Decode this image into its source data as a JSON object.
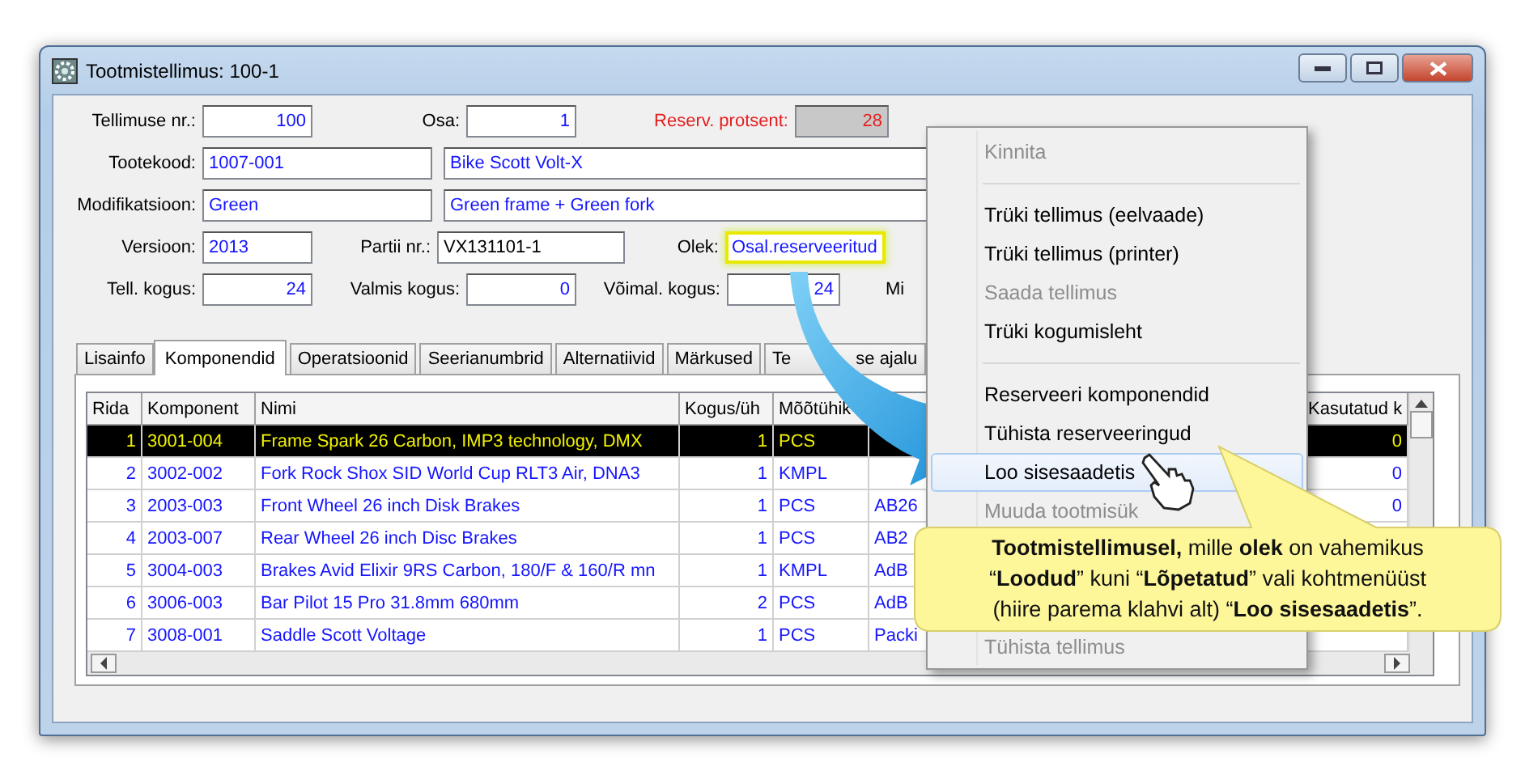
{
  "window": {
    "title": "Tootmistellimus: 100-1"
  },
  "form_rows": [
    [
      {
        "kind": "label",
        "text": "Tellimuse nr.:"
      },
      {
        "kind": "number_field",
        "text": "100"
      },
      {
        "kind": "label",
        "text": "Osa:"
      },
      {
        "kind": "number_field",
        "text": "1"
      },
      {
        "kind": "warning_label",
        "text": "Reserv. protsent:"
      },
      {
        "kind": "readonly_field",
        "text": "28"
      }
    ],
    [
      {
        "kind": "label",
        "text": "Tootekood:"
      },
      {
        "kind": "text_field",
        "text": "1007-001"
      },
      {
        "kind": "text_field",
        "text": "Bike Scott Volt-X"
      }
    ],
    [
      {
        "kind": "label",
        "text": "Modifikatsioon:"
      },
      {
        "kind": "text_field",
        "text": "Green"
      },
      {
        "kind": "text_field",
        "text": "Green frame + Green fork"
      }
    ],
    [
      {
        "kind": "label",
        "text": "Versioon:"
      },
      {
        "kind": "text_field",
        "text": "2013"
      },
      {
        "kind": "label",
        "text": "Partii nr.:"
      },
      {
        "kind": "plain_field",
        "text": "VX131101-1"
      },
      {
        "kind": "label",
        "text": "Olek:"
      },
      {
        "kind": "highlighted_field",
        "text": "Osal.reserveeritud"
      }
    ],
    [
      {
        "kind": "label",
        "text": "Tell. kogus:"
      },
      {
        "kind": "number_field",
        "text": "24"
      },
      {
        "kind": "label",
        "text": "Valmis kogus:"
      },
      {
        "kind": "number_field",
        "text": "0"
      },
      {
        "kind": "label",
        "text": "Võimal. kogus:"
      },
      {
        "kind": "number_field",
        "text": "24"
      },
      {
        "kind": "cut_label",
        "text": "Mi"
      }
    ]
  ],
  "tabs": [
    {
      "label": "Lisainfo",
      "selected": false
    },
    {
      "label": "Komponendid",
      "selected": true
    },
    {
      "label": "Operatsioonid",
      "selected": false
    },
    {
      "label": "Seerianumbrid",
      "selected": false
    },
    {
      "label": "Alternatiivid",
      "selected": false
    },
    {
      "label": "Märkused",
      "selected": false
    },
    {
      "label": "Te",
      "label_rest": "se ajalu",
      "selected": false
    }
  ],
  "table": {
    "columns": [
      "Rida",
      "Komponent",
      "Nimi",
      "Kogus/üh",
      "Mõõtühik"
    ],
    "last_column": "Kasutatud k",
    "rows": [
      {
        "cells": [
          "1",
          "3001-004",
          "Frame Spark 26 Carbon, IMP3 technology, DMX",
          "1",
          "PCS"
        ],
        "used": "0",
        "selected": true
      },
      {
        "cells": [
          "2",
          "3002-002",
          "Fork Rock Shox SID World Cup RLT3 Air, DNA3",
          "1",
          "KMPL"
        ],
        "used": "0",
        "selected": false
      },
      {
        "cells": [
          "3",
          "2003-003",
          "Front Wheel 26 inch Disk Brakes",
          "1",
          "PCS",
          "AB26"
        ],
        "used": "0",
        "selected": false
      },
      {
        "cells": [
          "4",
          "2003-007",
          "Rear Wheel 26 inch Disc Brakes",
          "1",
          "PCS",
          "AB2"
        ],
        "selected": false
      },
      {
        "cells": [
          "5",
          "3004-003",
          "Brakes Avid Elixir 9RS Carbon, 180/F & 160/R mn",
          "1",
          "KMPL",
          "AdB"
        ],
        "selected": false
      },
      {
        "cells": [
          "6",
          "3006-003",
          "Bar Pilot 15 Pro 31.8mm 680mm",
          "2",
          "PCS",
          "AdB"
        ],
        "selected": false
      },
      {
        "cells": [
          "7",
          "3008-001",
          "Saddle Scott Voltage",
          "1",
          "PCS",
          "Packi"
        ],
        "selected": false
      }
    ]
  },
  "context_menu": [
    {
      "kind": "item",
      "label": "Kinnita",
      "disabled": true,
      "selected": false
    },
    {
      "kind": "separator"
    },
    {
      "kind": "item",
      "label": "Trüki tellimus (eelvaade)",
      "disabled": false,
      "selected": false
    },
    {
      "kind": "item",
      "label": "Trüki tellimus (printer)",
      "disabled": false,
      "selected": false
    },
    {
      "kind": "item",
      "label": "Saada tellimus",
      "disabled": true,
      "selected": false
    },
    {
      "kind": "item",
      "label": "Trüki kogumisleht",
      "disabled": false,
      "selected": false
    },
    {
      "kind": "separator"
    },
    {
      "kind": "item",
      "label": "Reserveeri komponendid",
      "disabled": false,
      "selected": false
    },
    {
      "kind": "item",
      "label": "Tühista reserveeringud",
      "disabled": false,
      "selected": false
    },
    {
      "kind": "item",
      "label": "Loo sisesaadetis",
      "disabled": false,
      "selected": true
    },
    {
      "kind": "item",
      "label": "Muuda tootmisük",
      "disabled": true,
      "selected": false
    },
    {
      "kind": "item",
      "label": "Tühista tellimus",
      "disabled": true,
      "selected": false
    }
  ],
  "callout": {
    "lines": [
      "**Tootmistellimusel,** mille **olek** on vahemikus",
      "“**Loodud**”  kuni “**Lõpetatud**” vali kohtmenüüst",
      "(hiire parema klahvi alt) “**Loo sisesaadetis**”."
    ]
  }
}
